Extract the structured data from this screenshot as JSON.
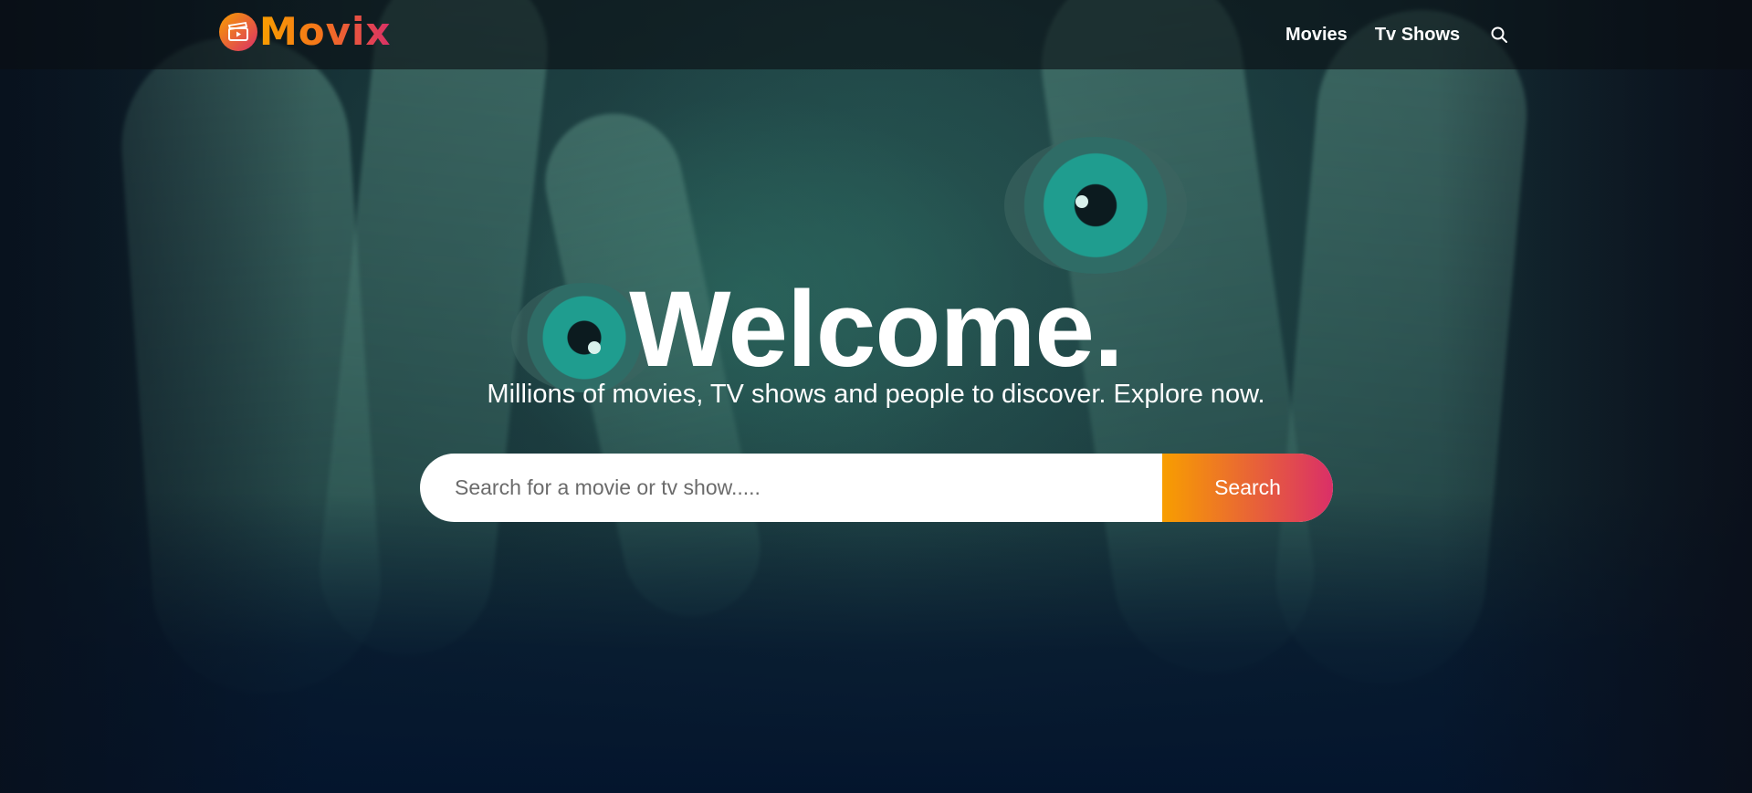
{
  "header": {
    "logo_text": "Movix",
    "nav": {
      "movies_label": "Movies",
      "tvshows_label": "Tv Shows",
      "search_icon": "search-icon"
    }
  },
  "hero": {
    "title": "Welcome.",
    "subtitle": "Millions of movies, TV shows and people to discover. Explore now.",
    "search": {
      "placeholder": "Search for a movie or tv show.....",
      "value": "",
      "button_label": "Search"
    }
  },
  "colors": {
    "gradient_start": "#f89e00",
    "gradient_end": "#da2f68",
    "background": "#04152d",
    "text": "#ffffff"
  }
}
